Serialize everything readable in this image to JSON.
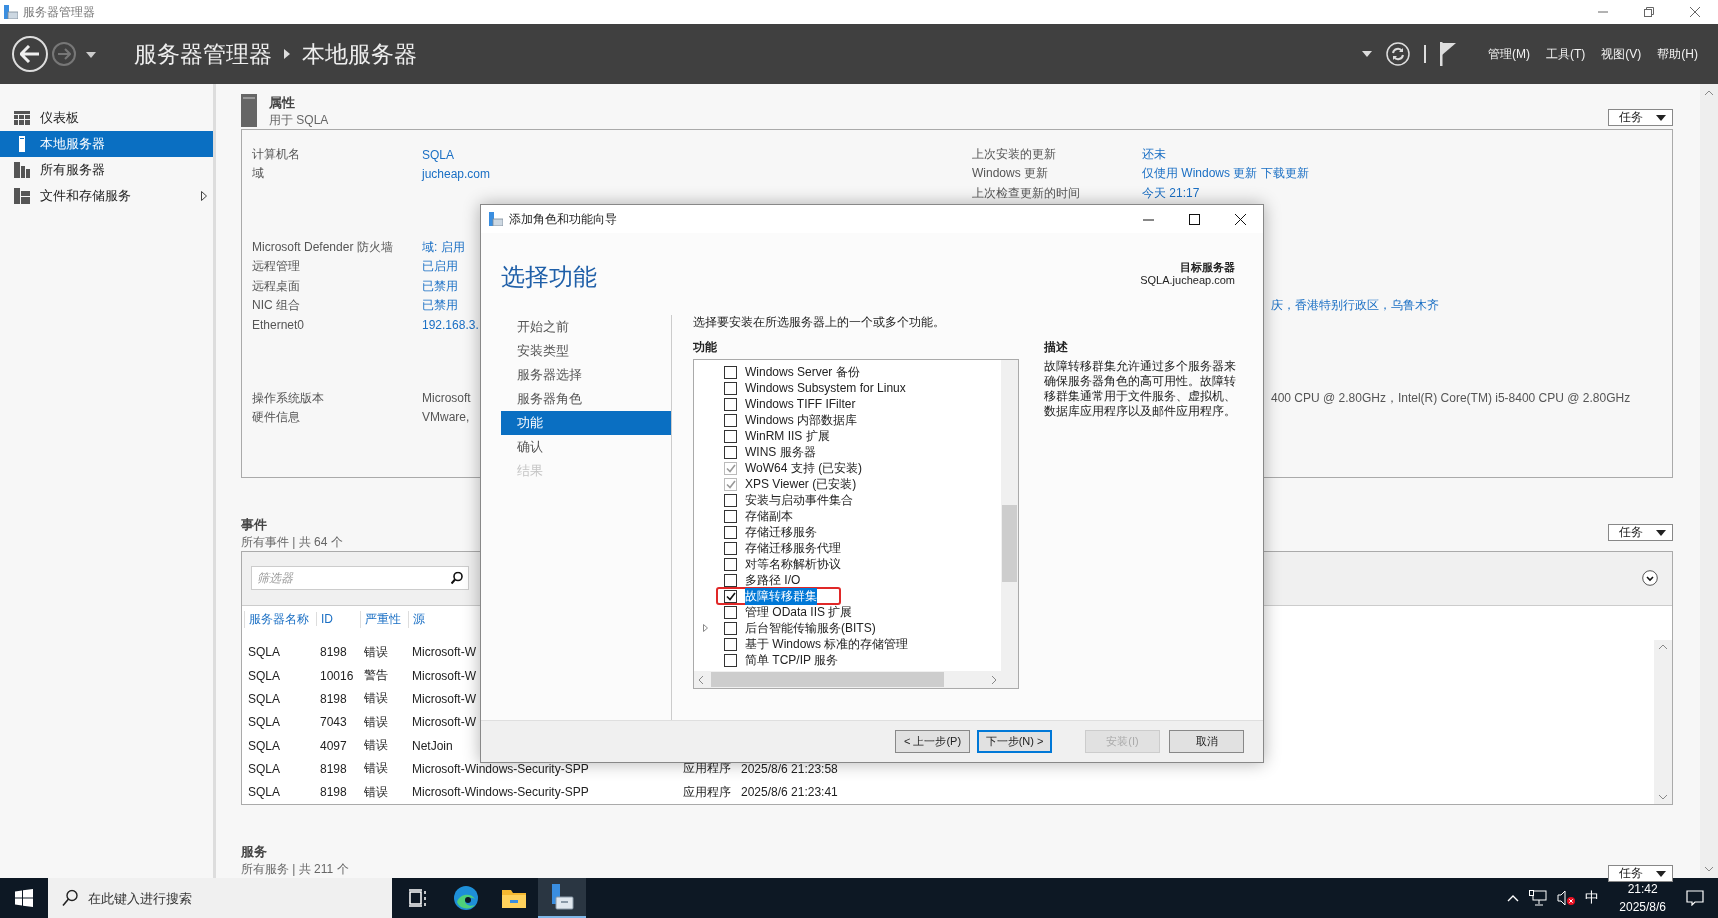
{
  "window": {
    "title": "服务器管理器"
  },
  "header": {
    "breadcrumb": [
      "服务器管理器",
      "本地服务器"
    ],
    "menus": [
      "管理(M)",
      "工具(T)",
      "视图(V)",
      "帮助(H)"
    ]
  },
  "sidebar": {
    "items": [
      {
        "label": "仪表板",
        "kind": "dashboard",
        "selected": false
      },
      {
        "label": "本地服务器",
        "kind": "server",
        "selected": true
      },
      {
        "label": "所有服务器",
        "kind": "servers",
        "selected": false
      },
      {
        "label": "文件和存储服务",
        "kind": "storage",
        "selected": false
      }
    ]
  },
  "properties": {
    "title": "属性",
    "subtitle": "用于 SQLA",
    "tasks": "任务",
    "groups": [
      {
        "rows": [
          {
            "label": "计算机名",
            "value": "SQLA",
            "right_label": "上次安装的更新",
            "right_value": "还未"
          },
          {
            "label": "域",
            "value": "jucheap.com",
            "right_label": "Windows 更新",
            "right_value": "仅使用 Windows 更新 下载更新"
          },
          {
            "right_label": "上次检查更新的时间",
            "right_value": "今天 21:17"
          }
        ]
      },
      {
        "rows": [
          {
            "label": "Microsoft Defender 防火墙",
            "value": "域: 启用"
          },
          {
            "label": "远程管理",
            "value": "已启用"
          },
          {
            "label": "远程桌面",
            "value": "已禁用"
          },
          {
            "label": "NIC 组合",
            "value": "已禁用",
            "right_cut_value": "庆，香港特别行政区，乌鲁木齐"
          },
          {
            "label": "Ethernet0",
            "value": "192.168.3."
          }
        ]
      },
      {
        "rows": [
          {
            "label": "操作系统版本",
            "value": "Microsoft",
            "right_cut_value": "400 CPU @ 2.80GHz，Intel(R) Core(TM) i5-8400 CPU @ 2.80GHz",
            "plain": true,
            "right_plain": true
          },
          {
            "label": "硬件信息",
            "value": "VMware,",
            "plain": true
          }
        ]
      }
    ]
  },
  "events": {
    "title": "事件",
    "subtitle": "所有事件 | 共 64 个",
    "tasks": "任务",
    "filter": {
      "placeholder": "筛选器"
    },
    "columns": [
      "服务器名称",
      "ID",
      "严重性",
      "源"
    ],
    "rows": [
      [
        "SQLA",
        "8198",
        "错误",
        "Microsoft-W"
      ],
      [
        "SQLA",
        "10016",
        "警告",
        "Microsoft-W"
      ],
      [
        "SQLA",
        "8198",
        "错误",
        "Microsoft-W"
      ],
      [
        "SQLA",
        "7043",
        "错误",
        "Microsoft-W"
      ],
      [
        "SQLA",
        "4097",
        "错误",
        "NetJoin"
      ],
      [
        "SQLA",
        "8198",
        "错误",
        "Microsoft-Windows-Security-SPP",
        "应用程序",
        "2025/8/6 21:23:58"
      ],
      [
        "SQLA",
        "8198",
        "错误",
        "Microsoft-Windows-Security-SPP",
        "应用程序",
        "2025/8/6 21:23:41"
      ]
    ]
  },
  "services": {
    "title": "服务",
    "subtitle": "所有服务 | 共 211 个",
    "tasks": "任务"
  },
  "dialog": {
    "title": "添加角色和功能向导",
    "heading": "选择功能",
    "target_label": "目标服务器",
    "target_value": "SQLA.jucheap.com",
    "steps": [
      {
        "label": "开始之前",
        "selected": false,
        "disabled": false
      },
      {
        "label": "安装类型",
        "selected": false,
        "disabled": false
      },
      {
        "label": "服务器选择",
        "selected": false,
        "disabled": false
      },
      {
        "label": "服务器角色",
        "selected": false,
        "disabled": false
      },
      {
        "label": "功能",
        "selected": true,
        "disabled": false
      },
      {
        "label": "确认",
        "selected": false,
        "disabled": false
      },
      {
        "label": "结果",
        "selected": false,
        "disabled": true
      }
    ],
    "intro": "选择要安装在所选服务器上的一个或多个功能。",
    "features_label": "功能",
    "features": [
      {
        "label": "Windows Server 备份",
        "kind": "leaf",
        "checked": false,
        "disabled": false,
        "selected": false
      },
      {
        "label": "Windows Subsystem for Linux",
        "kind": "leaf",
        "checked": false,
        "disabled": false,
        "selected": false
      },
      {
        "label": "Windows TIFF IFilter",
        "kind": "leaf",
        "checked": false,
        "disabled": false,
        "selected": false
      },
      {
        "label": "Windows 内部数据库",
        "kind": "leaf",
        "checked": false,
        "disabled": false,
        "selected": false
      },
      {
        "label": "WinRM IIS 扩展",
        "kind": "leaf",
        "checked": false,
        "disabled": false,
        "selected": false
      },
      {
        "label": "WINS 服务器",
        "kind": "leaf",
        "checked": false,
        "disabled": false,
        "selected": false
      },
      {
        "label": "WoW64 支持 (已安装)",
        "kind": "leaf",
        "checked": true,
        "disabled": true,
        "selected": false
      },
      {
        "label": "XPS Viewer (已安装)",
        "kind": "leaf",
        "checked": true,
        "disabled": true,
        "selected": false
      },
      {
        "label": "安装与启动事件集合",
        "kind": "leaf",
        "checked": false,
        "disabled": false,
        "selected": false
      },
      {
        "label": "存储副本",
        "kind": "leaf",
        "checked": false,
        "disabled": false,
        "selected": false
      },
      {
        "label": "存储迁移服务",
        "kind": "leaf",
        "checked": false,
        "disabled": false,
        "selected": false
      },
      {
        "label": "存储迁移服务代理",
        "kind": "leaf",
        "checked": false,
        "disabled": false,
        "selected": false
      },
      {
        "label": "对等名称解析协议",
        "kind": "leaf",
        "checked": false,
        "disabled": false,
        "selected": false
      },
      {
        "label": "多路径 I/O",
        "kind": "leaf",
        "checked": false,
        "disabled": false,
        "selected": false
      },
      {
        "label": "故障转移群集",
        "kind": "leaf",
        "checked": true,
        "disabled": false,
        "selected": true
      },
      {
        "label": "管理 OData IIS 扩展",
        "kind": "leaf",
        "checked": false,
        "disabled": false,
        "selected": false
      },
      {
        "label": "后台智能传输服务(BITS)",
        "kind": "parent",
        "checked": false,
        "disabled": false,
        "selected": false
      },
      {
        "label": "基于 Windows 标准的存储管理",
        "kind": "leaf",
        "checked": false,
        "disabled": false,
        "selected": false
      },
      {
        "label": "简单 TCP/IP 服务",
        "kind": "leaf",
        "checked": false,
        "disabled": false,
        "selected": false
      }
    ],
    "description_label": "描述",
    "description": "故障转移群集允许通过多个服务器来确保服务器角色的高可用性。故障转移群集通常用于文件服务、虚拟机、数据库应用程序以及邮件应用程序。",
    "buttons": [
      {
        "label": "< 上一步(P)",
        "disabled": false,
        "focused": false
      },
      {
        "label": "下一步(N) >",
        "disabled": false,
        "focused": true
      },
      {
        "label": "安装(I)",
        "disabled": true,
        "focused": false
      },
      {
        "label": "取消",
        "disabled": false,
        "focused": false
      }
    ]
  },
  "taskbar": {
    "search_placeholder": "在此键入进行搜索",
    "apps": [
      {
        "kind": "taskview",
        "active": false
      },
      {
        "kind": "browser",
        "active": false
      },
      {
        "kind": "folder",
        "active": false
      },
      {
        "kind": "servermanager",
        "active": true
      }
    ],
    "ime": "中",
    "time": "21:42",
    "date": "2025/8/6"
  }
}
